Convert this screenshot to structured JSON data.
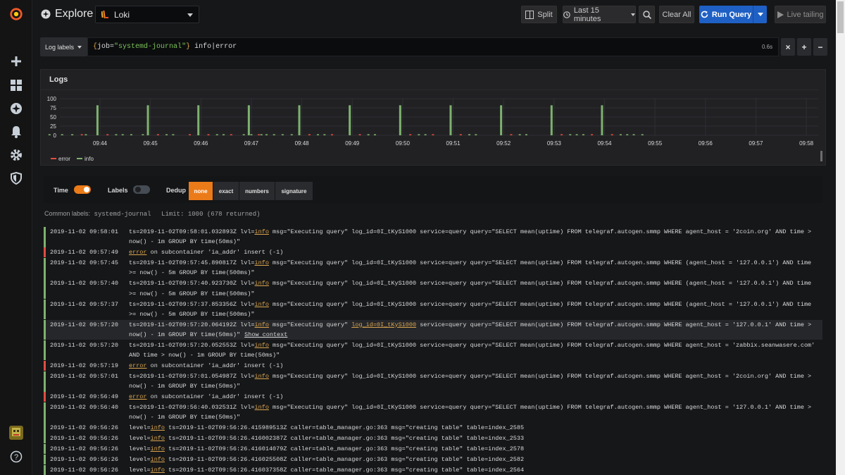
{
  "sidebar": {
    "items": [
      "grafana-logo",
      "add",
      "dashboards",
      "explore",
      "alerting",
      "configuration",
      "server-admin",
      "user-avatar",
      "help"
    ]
  },
  "header": {
    "title": "Explore",
    "datasource": "Loki",
    "split_label": "Split",
    "time_range": "Last 15 minutes",
    "clear_label": "Clear All",
    "run_label": "Run Query",
    "live_label": "Live tailing"
  },
  "query": {
    "log_labels": "Log labels",
    "brace_open": "{",
    "key": "job",
    "eq": "=",
    "value": "\"systemd-journal\"",
    "brace_close": "}",
    "text": " info|error",
    "duration": "0.6s"
  },
  "panel": {
    "title": "Logs",
    "legend": [
      {
        "name": "error",
        "color": "#e24d42"
      },
      {
        "name": "info",
        "color": "#7eb26d"
      }
    ]
  },
  "chart_data": {
    "type": "bar",
    "ylim": [
      0,
      100
    ],
    "yticks": [
      "100",
      "75",
      "50",
      "25",
      "0"
    ],
    "xticks": [
      "09:44",
      "09:45",
      "09:46",
      "09:47",
      "09:48",
      "09:49",
      "09:50",
      "09:51",
      "09:52",
      "09:53",
      "09:54",
      "09:55",
      "09:56",
      "09:57",
      "09:58"
    ],
    "series": [
      {
        "name": "info",
        "color": "#7eb26d",
        "points": [
          [
            -1.0,
            3
          ],
          [
            -0.75,
            3
          ],
          [
            -0.55,
            3
          ],
          [
            -0.28,
            3
          ],
          [
            -0.05,
            82
          ],
          [
            0.32,
            3
          ],
          [
            0.45,
            3
          ],
          [
            0.62,
            3
          ],
          [
            0.85,
            3
          ],
          [
            0.95,
            82
          ],
          [
            1.32,
            3
          ],
          [
            1.45,
            3
          ],
          [
            1.95,
            82
          ],
          [
            2.32,
            3
          ],
          [
            2.45,
            3
          ],
          [
            2.85,
            3
          ],
          [
            2.95,
            82
          ],
          [
            3.0,
            3
          ],
          [
            3.2,
            3
          ],
          [
            3.3,
            3
          ],
          [
            3.45,
            3
          ],
          [
            3.62,
            3
          ],
          [
            3.8,
            3
          ],
          [
            3.95,
            82
          ],
          [
            4.32,
            3
          ],
          [
            4.45,
            3
          ],
          [
            4.95,
            82
          ],
          [
            5.32,
            3
          ],
          [
            5.45,
            3
          ],
          [
            5.95,
            82
          ],
          [
            6.32,
            3
          ],
          [
            6.45,
            3
          ],
          [
            6.95,
            82
          ],
          [
            7.32,
            3
          ],
          [
            7.45,
            3
          ],
          [
            7.95,
            82
          ],
          [
            8.32,
            3
          ],
          [
            8.45,
            3
          ],
          [
            8.95,
            82
          ],
          [
            9.32,
            3
          ],
          [
            9.45,
            3
          ],
          [
            9.58,
            3
          ],
          [
            9.95,
            82
          ],
          [
            10.32,
            3
          ],
          [
            10.45,
            3
          ],
          [
            10.58,
            3
          ],
          [
            10.75,
            3
          ]
        ]
      },
      {
        "name": "error",
        "color": "#e24d42",
        "points": [
          [
            -0.36,
            3
          ],
          [
            0.15,
            3
          ],
          [
            1.15,
            3
          ],
          [
            1.78,
            3
          ],
          [
            2.15,
            3
          ],
          [
            2.6,
            3
          ],
          [
            3.15,
            3
          ],
          [
            4.15,
            3
          ],
          [
            4.6,
            3
          ],
          [
            5.15,
            3
          ],
          [
            6.15,
            3
          ],
          [
            6.6,
            3
          ],
          [
            7.15,
            3
          ],
          [
            8.15,
            3
          ],
          [
            9.15,
            3
          ],
          [
            9.75,
            3
          ],
          [
            10.15,
            3
          ]
        ]
      }
    ]
  },
  "controls": {
    "time_label": "Time",
    "labels_label": "Labels",
    "dedup_label": "Dedup",
    "dedup_options": [
      "none",
      "exact",
      "numbers",
      "signature"
    ]
  },
  "common": {
    "label": "Common labels:",
    "value": "systemd-journal",
    "limit": "Limit: 1000 (678 returned)"
  },
  "logs": [
    {
      "level": "info",
      "ts": "2019-11-02 09:58:01",
      "parts": [
        [
          "ts=2019-11-02T09:58:01.032893Z lvl=",
          ""
        ],
        [
          "info",
          "kw"
        ],
        [
          " msg=\"Executing query\" log_id=0I_tKyS1000 service=query query=\"SELECT mean(uptime) FROM telegraf.autogen.smmp WHERE agent_host = '2coin.org' AND time > now() - 1m GROUP BY time(50ms)\"",
          ""
        ]
      ]
    },
    {
      "level": "error",
      "ts": "2019-11-02 09:57:49",
      "parts": [
        [
          "error",
          "kw"
        ],
        [
          " on subcontainer 'ia_addr' insert (-1)",
          ""
        ]
      ]
    },
    {
      "level": "info",
      "ts": "2019-11-02 09:57:45",
      "parts": [
        [
          "ts=2019-11-02T09:57:45.890817Z lvl=",
          ""
        ],
        [
          "info",
          "kw"
        ],
        [
          " msg=\"Executing query\" log_id=0I_tKyS1000 service=query query=\"SELECT mean(uptime) FROM telegraf.autogen.smmp WHERE (agent_host = '127.0.0.1') AND time >= now() - 5m GROUP BY time(500ms)\"",
          ""
        ]
      ]
    },
    {
      "level": "info",
      "ts": "2019-11-02 09:57:40",
      "parts": [
        [
          "ts=2019-11-02T09:57:40.923730Z lvl=",
          ""
        ],
        [
          "info",
          "kw"
        ],
        [
          " msg=\"Executing query\" log_id=0I_tKyS1000 service=query query=\"SELECT mean(uptime) FROM telegraf.autogen.smmp WHERE (agent_host = '127.0.0.1') AND time >= now() - 5m GROUP BY time(500ms)\"",
          ""
        ]
      ]
    },
    {
      "level": "info",
      "ts": "2019-11-02 09:57:37",
      "parts": [
        [
          "ts=2019-11-02T09:57:37.853356Z lvl=",
          ""
        ],
        [
          "info",
          "kw"
        ],
        [
          " msg=\"Executing query\" log_id=0I_tKyS1000 service=query query=\"SELECT mean(uptime) FROM telegraf.autogen.smmp WHERE (agent_host = '127.0.0.1') AND time >= now() - 5m GROUP BY time(500ms)\"",
          ""
        ]
      ]
    },
    {
      "level": "info",
      "ts": "2019-11-02 09:57:20",
      "hl": true,
      "ctx": "Show context",
      "parts": [
        [
          "ts=2019-11-02T09:57:20.064192Z lvl=",
          ""
        ],
        [
          "info",
          "kw"
        ],
        [
          " msg=\"Executing query\" ",
          ""
        ],
        [
          "log_id=0I_tKyS1000",
          "kw"
        ],
        [
          " service=query query=\"SELECT mean(uptime) FROM telegraf.autogen.smmp WHERE agent_host = '127.0.0.1' AND time > now() - 1m GROUP BY time(50ms)\"",
          ""
        ]
      ]
    },
    {
      "level": "info",
      "ts": "2019-11-02 09:57:20",
      "parts": [
        [
          "ts=2019-11-02T09:57:20.052553Z lvl=",
          ""
        ],
        [
          "info",
          "kw"
        ],
        [
          " msg=\"Executing query\" log_id=0I_tKyS1000 service=query query=\"SELECT mean(uptime) FROM telegraf.autogen.smmp WHERE agent_host = 'zabbix.seanwasere.com' AND time > now() - 1m GROUP BY time(50ms)\"",
          ""
        ]
      ]
    },
    {
      "level": "error",
      "ts": "2019-11-02 09:57:19",
      "parts": [
        [
          "error",
          "kw"
        ],
        [
          " on subcontainer 'ia_addr' insert (-1)",
          ""
        ]
      ]
    },
    {
      "level": "info",
      "ts": "2019-11-02 09:57:01",
      "parts": [
        [
          "ts=2019-11-02T09:57:01.054987Z lvl=",
          ""
        ],
        [
          "info",
          "kw"
        ],
        [
          " msg=\"Executing query\" log_id=0I_tKyS1000 service=query query=\"SELECT mean(uptime) FROM telegraf.autogen.smmp WHERE agent_host = '2coin.org' AND time > now() - 1m GROUP BY time(50ms)\"",
          ""
        ]
      ]
    },
    {
      "level": "error",
      "ts": "2019-11-02 09:56:49",
      "parts": [
        [
          "error",
          "kw"
        ],
        [
          " on subcontainer 'ia_addr' insert (-1)",
          ""
        ]
      ]
    },
    {
      "level": "info",
      "ts": "2019-11-02 09:56:40",
      "parts": [
        [
          "ts=2019-11-02T09:56:40.032531Z lvl=",
          ""
        ],
        [
          "info",
          "kw"
        ],
        [
          " msg=\"Executing query\" log_id=0I_tKyS1000 service=query query=\"SELECT mean(uptime) FROM telegraf.autogen.smmp WHERE agent_host = '127.0.0.1' AND time > now() - 1m GROUP BY time(50ms)\"",
          ""
        ]
      ]
    },
    {
      "level": "info",
      "ts": "2019-11-02 09:56:26",
      "parts": [
        [
          "level=",
          ""
        ],
        [
          "info",
          "kw"
        ],
        [
          " ts=2019-11-02T09:56:26.415989513Z caller=table_manager.go:363 msg=\"creating table\" table=index_2585",
          ""
        ]
      ]
    },
    {
      "level": "info",
      "ts": "2019-11-02 09:56:26",
      "parts": [
        [
          "level=",
          ""
        ],
        [
          "info",
          "kw"
        ],
        [
          " ts=2019-11-02T09:56:26.416002387Z caller=table_manager.go:363 msg=\"creating table\" table=index_2533",
          ""
        ]
      ]
    },
    {
      "level": "info",
      "ts": "2019-11-02 09:56:26",
      "parts": [
        [
          "level=",
          ""
        ],
        [
          "info",
          "kw"
        ],
        [
          " ts=2019-11-02T09:56:26.416014079Z caller=table_manager.go:363 msg=\"creating table\" table=index_2578",
          ""
        ]
      ]
    },
    {
      "level": "info",
      "ts": "2019-11-02 09:56:26",
      "parts": [
        [
          "level=",
          ""
        ],
        [
          "info",
          "kw"
        ],
        [
          " ts=2019-11-02T09:56:26.416025508Z caller=table_manager.go:363 msg=\"creating table\" table=index_2582",
          ""
        ]
      ]
    },
    {
      "level": "info",
      "ts": "2019-11-02 09:56:26",
      "parts": [
        [
          "level=",
          ""
        ],
        [
          "info",
          "kw"
        ],
        [
          " ts=2019-11-02T09:56:26.416037358Z caller=table_manager.go:363 msg=\"creating table\" table=index_2564",
          ""
        ]
      ]
    }
  ],
  "colors": {
    "info": "#7eb26d",
    "error": "#e24d42",
    "accent": "#eb7b18",
    "run": "#1f60c4"
  }
}
